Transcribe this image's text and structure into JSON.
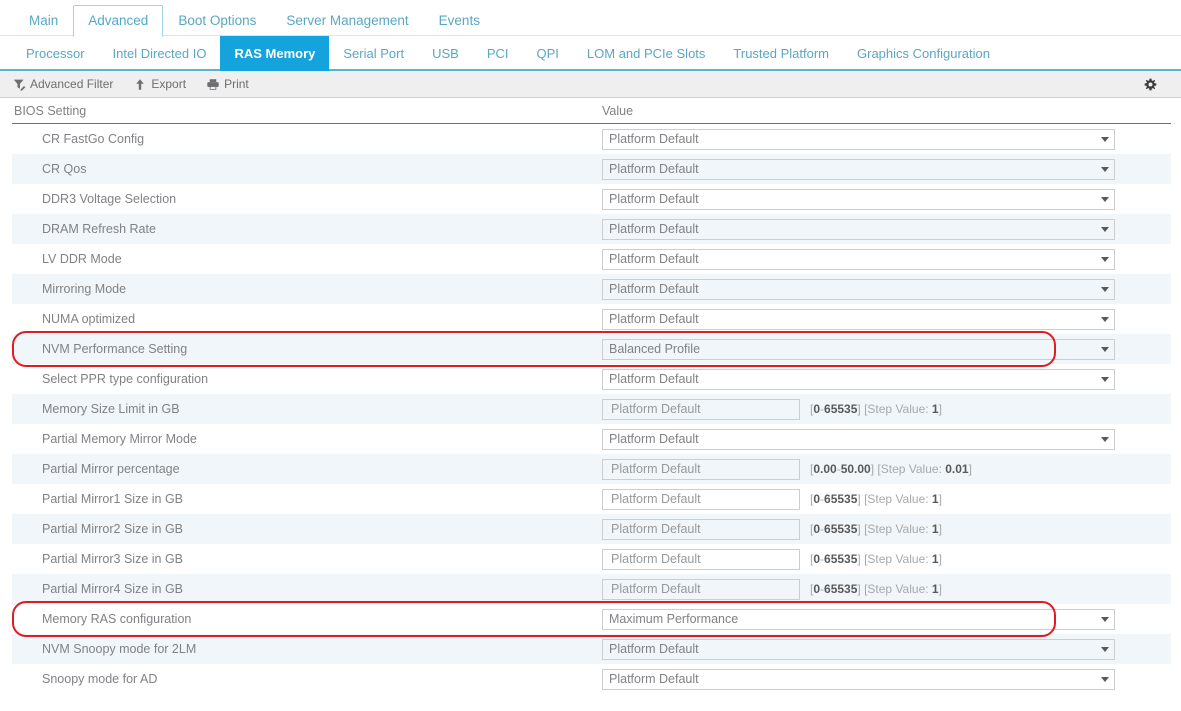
{
  "primary_tabs": [
    {
      "label": "Main",
      "active": false
    },
    {
      "label": "Advanced",
      "active": true
    },
    {
      "label": "Boot Options",
      "active": false
    },
    {
      "label": "Server Management",
      "active": false
    },
    {
      "label": "Events",
      "active": false
    }
  ],
  "secondary_tabs": [
    {
      "label": "Processor",
      "active": false
    },
    {
      "label": "Intel Directed IO",
      "active": false
    },
    {
      "label": "RAS Memory",
      "active": true
    },
    {
      "label": "Serial Port",
      "active": false
    },
    {
      "label": "USB",
      "active": false
    },
    {
      "label": "PCI",
      "active": false
    },
    {
      "label": "QPI",
      "active": false
    },
    {
      "label": "LOM and PCIe Slots",
      "active": false
    },
    {
      "label": "Trusted Platform",
      "active": false
    },
    {
      "label": "Graphics Configuration",
      "active": false
    }
  ],
  "toolbar": {
    "advanced_filter_label": "Advanced Filter",
    "export_label": "Export",
    "print_label": "Print",
    "filter_icon": "funnel-edit-icon",
    "export_icon": "up-arrow-icon",
    "print_icon": "printer-icon",
    "settings_icon": "gear-icon"
  },
  "table": {
    "columns": [
      "BIOS Setting",
      "Value"
    ],
    "rows": [
      {
        "name": "CR FastGo Config",
        "type": "select",
        "value": "Platform Default",
        "highlight": false
      },
      {
        "name": "CR Qos",
        "type": "select",
        "value": "Platform Default",
        "highlight": false
      },
      {
        "name": "DDR3 Voltage Selection",
        "type": "select",
        "value": "Platform Default",
        "highlight": false
      },
      {
        "name": "DRAM Refresh Rate",
        "type": "select",
        "value": "Platform Default",
        "highlight": false
      },
      {
        "name": "LV DDR Mode",
        "type": "select",
        "value": "Platform Default",
        "highlight": false
      },
      {
        "name": "Mirroring Mode",
        "type": "select",
        "value": "Platform Default",
        "highlight": false
      },
      {
        "name": "NUMA optimized",
        "type": "select",
        "value": "Platform Default",
        "highlight": false
      },
      {
        "name": "NVM Performance Setting",
        "type": "select",
        "value": "Balanced Profile",
        "highlight": true
      },
      {
        "name": "Select PPR type configuration",
        "type": "select",
        "value": "Platform Default",
        "highlight": false
      },
      {
        "name": "Memory Size Limit in GB",
        "type": "number",
        "value": "Platform Default",
        "range_min": "0",
        "range_max": "65535",
        "step_label": "Step Value:",
        "step": "1",
        "highlight": false
      },
      {
        "name": "Partial Memory Mirror Mode",
        "type": "select",
        "value": "Platform Default",
        "highlight": false
      },
      {
        "name": "Partial Mirror percentage",
        "type": "number",
        "value": "Platform Default",
        "range_min": "0.00",
        "range_max": "50.00",
        "step_label": "Step Value:",
        "step": "0.01",
        "highlight": false
      },
      {
        "name": "Partial Mirror1 Size in GB",
        "type": "number",
        "value": "Platform Default",
        "range_min": "0",
        "range_max": "65535",
        "step_label": "Step Value:",
        "step": "1",
        "highlight": false
      },
      {
        "name": "Partial Mirror2 Size in GB",
        "type": "number",
        "value": "Platform Default",
        "range_min": "0",
        "range_max": "65535",
        "step_label": "Step Value:",
        "step": "1",
        "highlight": false
      },
      {
        "name": "Partial Mirror3 Size in GB",
        "type": "number",
        "value": "Platform Default",
        "range_min": "0",
        "range_max": "65535",
        "step_label": "Step Value:",
        "step": "1",
        "highlight": false
      },
      {
        "name": "Partial Mirror4 Size in GB",
        "type": "number",
        "value": "Platform Default",
        "range_min": "0",
        "range_max": "65535",
        "step_label": "Step Value:",
        "step": "1",
        "highlight": false
      },
      {
        "name": "Memory RAS configuration",
        "type": "select",
        "value": "Maximum Performance",
        "highlight": true
      },
      {
        "name": "NVM Snoopy mode for 2LM",
        "type": "select",
        "value": "Platform Default",
        "highlight": false
      },
      {
        "name": "Snoopy mode for AD",
        "type": "select",
        "value": "Platform Default",
        "highlight": false
      }
    ]
  },
  "colors": {
    "accent_blue": "#14a3dc",
    "tab_link": "#5aa7c4",
    "annotation_red": "#e01b22",
    "row_alt": "#f0f6f9",
    "toolbar_bg": "#efefef"
  }
}
